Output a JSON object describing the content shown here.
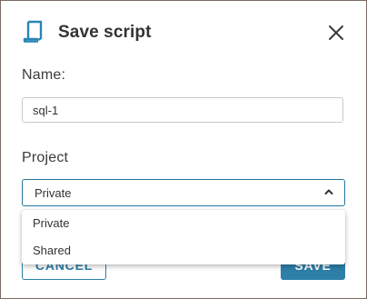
{
  "dialog": {
    "title": "Save script",
    "icon": "script-icon",
    "close_icon": "close-icon",
    "name_label": "Name:",
    "name_value": "sql-1",
    "project_label": "Project",
    "project_selected": "Private",
    "project_options": [
      "Private",
      "Shared"
    ],
    "cancel_label": "Cancel",
    "save_label": "Save",
    "colors": {
      "accent": "#2d7fa8",
      "focus_border": "#23789c",
      "icon": "#2a86b4",
      "border": "#7a6a62"
    }
  }
}
